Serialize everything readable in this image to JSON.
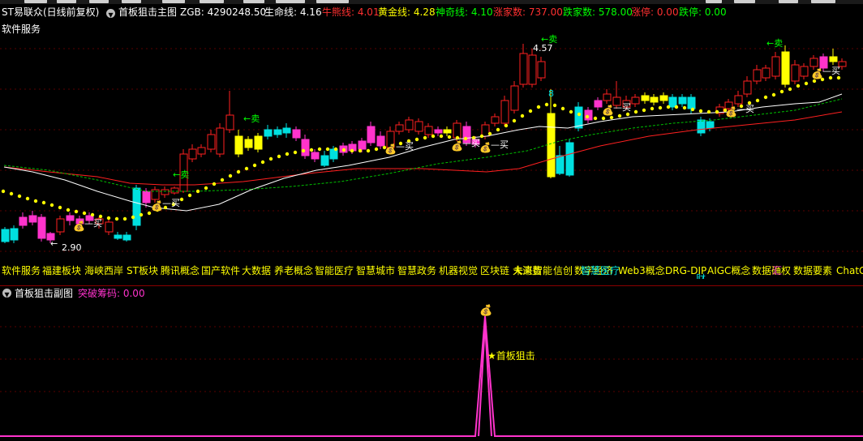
{
  "main_header": {
    "stock_name": "ST易联众(日线前复权)",
    "indicator_name": "首板狙击主图",
    "zgb_label": "ZGB: 4290248.50",
    "life_label": "生命线: 4.16",
    "bull_label": "牛熊线: 4.01",
    "gold_label": "黄金线: 4.28",
    "magic_label": "神奇线: 4.10",
    "up_count_label": "涨家数: 737.00",
    "down_count_label": "跌家数: 578.00",
    "limit_up_label": "涨停: 0.00",
    "limit_down_label": "跌停: 0.00"
  },
  "sector": "软件服务",
  "price_labels": {
    "high": "4.57",
    "low": "2.90",
    "mark_8": "8"
  },
  "signals": {
    "sell": "←卖",
    "buy": "买"
  },
  "concepts": [
    "软件服务",
    "福建板块",
    "海峡西岸",
    "ST板块",
    "腾讯概念",
    "国产软件",
    "大数据",
    "养老概念",
    "智能医疗",
    "智慧城市",
    "智慧政务",
    "机器视觉",
    "区块链",
    "未来智能",
    "信创",
    "数字经济",
    "Web3概念",
    "DRG-DIP",
    "AIGC概念",
    "数据确权",
    "数据要素",
    "ChatG"
  ],
  "overlays": [
    "大消费",
    "智慧医疗",
    "财",
    "汇"
  ],
  "sub_header": {
    "indicator_name": "首板狙击副图",
    "breakout_label": "突破筹码: 0.00"
  },
  "sub_annotation": "★首板狙击",
  "colors": {
    "up": "#ff2020",
    "down": "#00e0e0",
    "gold": "#ffff00",
    "pink": "#ff33cc",
    "white": "#ffffff",
    "green": "#00ff00",
    "dotted_gold": "#ffff00"
  }
}
